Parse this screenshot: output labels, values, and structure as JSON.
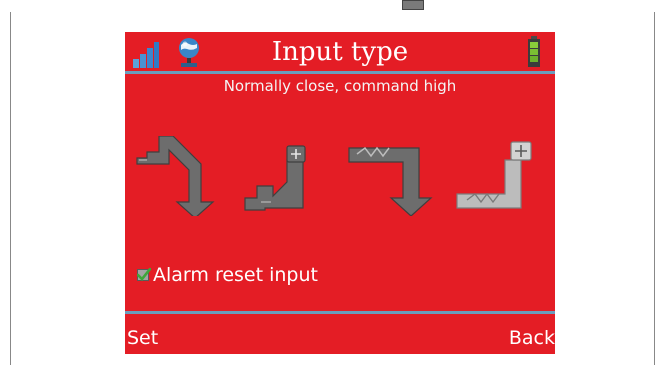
{
  "screen": {
    "title": "Input type",
    "subtitle": "Normally close, command high",
    "alarm_reset": {
      "label": "Alarm reset input",
      "checked": true
    },
    "softkeys": {
      "left": "Set",
      "right": "Back"
    },
    "input_type_icons": [
      {
        "icon": "nc-command-low-icon"
      },
      {
        "icon": "nc-command-high-icon"
      },
      {
        "icon": "no-command-low-icon"
      },
      {
        "icon": "no-command-high-icon"
      }
    ],
    "status_bar": {
      "icons": [
        "signal-strength-icon",
        "network-globe-icon",
        "battery-icon"
      ]
    },
    "colors": {
      "background": "#e41d25",
      "separator": "#6b9dbd",
      "text": "#ffffff",
      "symbol_dark": "#6d6d6d",
      "symbol_light": "#bcbcbc",
      "check": "#3fa63a"
    }
  }
}
